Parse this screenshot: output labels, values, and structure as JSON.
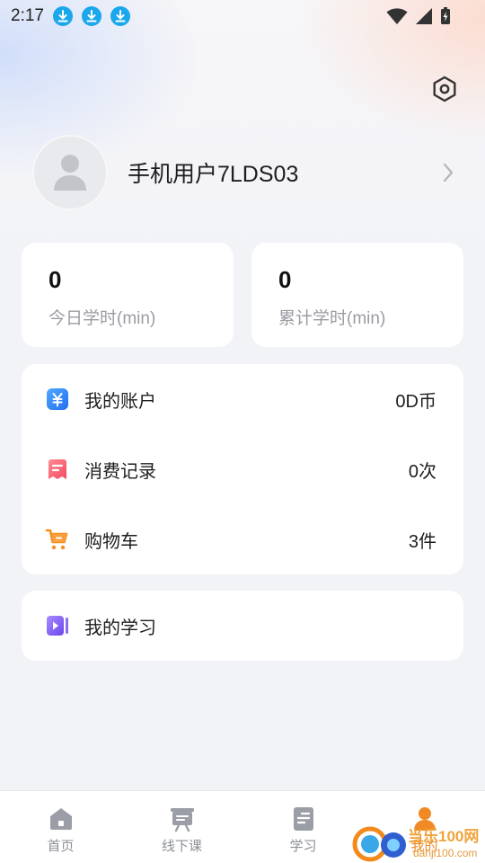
{
  "status_bar": {
    "time": "2:17",
    "download_icons": [
      "download-icon",
      "download-icon",
      "download-icon"
    ],
    "right_icons": [
      "wifi-icon",
      "signal-icon",
      "battery-charging-icon"
    ]
  },
  "header": {
    "settings_icon": "gear-icon"
  },
  "profile": {
    "username": "手机用户7LDS03",
    "avatar_icon": "user-avatar-icon"
  },
  "stats": [
    {
      "value": "0",
      "label": "今日学时(min)"
    },
    {
      "value": "0",
      "label": "累计学时(min)"
    }
  ],
  "menu": [
    {
      "icon": "wallet-icon",
      "label": "我的账户",
      "value": "0D币",
      "color": "#2f86f6"
    },
    {
      "icon": "record-icon",
      "label": "消费记录",
      "value": "0次",
      "color": "#f4606e"
    },
    {
      "icon": "cart-icon",
      "label": "购物车",
      "value": "3件",
      "color": "#f5901e"
    }
  ],
  "study": {
    "icon": "play-icon",
    "label": "我的学习",
    "color": "#7a5cf0"
  },
  "tabbar": [
    {
      "icon": "home-icon",
      "label": "首页"
    },
    {
      "icon": "offline-class-icon",
      "label": "线下课"
    },
    {
      "icon": "study-icon",
      "label": "学习"
    },
    {
      "icon": "profile-icon",
      "label": "我的",
      "active": true
    }
  ],
  "watermark": {
    "text": "当乐100网",
    "url": "danji100.com"
  },
  "colors": {
    "accent": "#f08a24",
    "background": "#f2f3f7"
  }
}
